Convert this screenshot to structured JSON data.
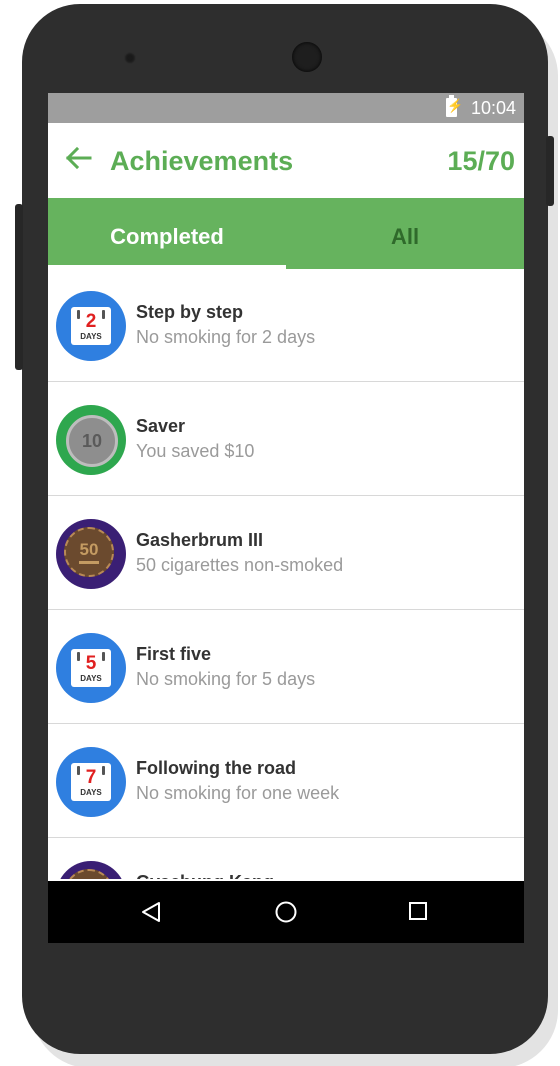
{
  "status_bar": {
    "time": "10:04",
    "battery_icon": "battery-charging-icon"
  },
  "app_bar": {
    "title": "Achievements",
    "count": "15/70",
    "back_icon": "arrow-left-icon"
  },
  "tabs": [
    {
      "label": "Completed",
      "selected": true
    },
    {
      "label": "All",
      "selected": false
    }
  ],
  "colors": {
    "brand_green": "#5cad55",
    "tab_bar_green": "#66b35e",
    "tab_inactive_text": "#2f6a2b",
    "badge_blue": "#2f7fe0",
    "badge_green": "#2ea74e",
    "badge_purple": "#3a1f74"
  },
  "achievements": [
    {
      "title": "Step by step",
      "subtitle": "No smoking for 2 days",
      "badge": {
        "type": "calendar",
        "value": "2",
        "unit": "DAYS"
      }
    },
    {
      "title": "Saver",
      "subtitle": "You saved $10",
      "badge": {
        "type": "coin",
        "value": "10"
      }
    },
    {
      "title": "Gasherbrum III",
      "subtitle": "50 cigarettes non-smoked",
      "badge": {
        "type": "chip",
        "value": "50"
      }
    },
    {
      "title": "First five",
      "subtitle": "No smoking for 5 days",
      "badge": {
        "type": "calendar",
        "value": "5",
        "unit": "DAYS"
      }
    },
    {
      "title": "Following the road",
      "subtitle": "No smoking for one week",
      "badge": {
        "type": "calendar",
        "value": "7",
        "unit": "DAYS"
      }
    },
    {
      "title": "Gyachung Kang",
      "subtitle": "",
      "badge": {
        "type": "chip",
        "value": ""
      }
    }
  ],
  "nav_bar": {
    "icons": [
      "back-triangle-icon",
      "home-circle-icon",
      "recent-apps-square-icon"
    ]
  }
}
